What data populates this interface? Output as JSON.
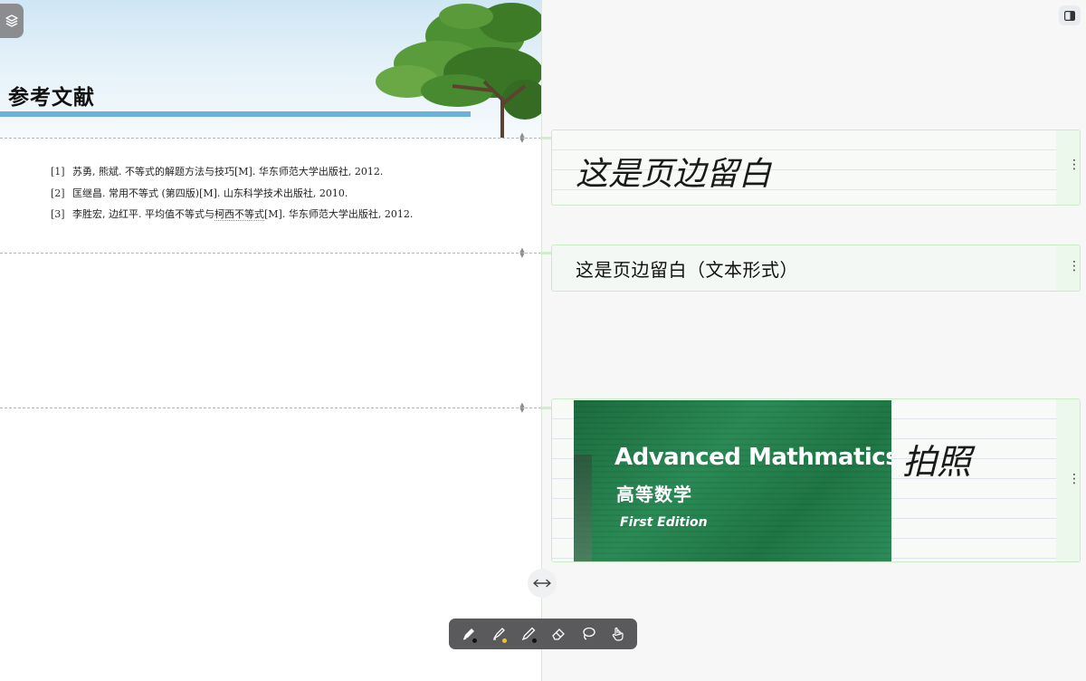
{
  "page": {
    "title": "参考文献",
    "references": [
      {
        "num": "[1]",
        "text": "苏勇, 熊斌. 不等式的解题方法与技巧[M]. 华东师范大学出版社, 2012."
      },
      {
        "num": "[2]",
        "text": "匡继昌. 常用不等式 (第四版)[M]. 山东科学技术出版社, 2010."
      },
      {
        "num": "[3]",
        "text_pre": "李胜宏, 边红平. 平均值不等式与",
        "text_mark": "柯西不等式",
        "text_post": "[M]. 华东师范大学出版社, 2012."
      }
    ]
  },
  "margin_notes": [
    {
      "type": "handwriting",
      "text": "这是页边留白"
    },
    {
      "type": "text",
      "text": "这是页边留白（文本形式）"
    },
    {
      "type": "image",
      "photo": {
        "title": "Advanced Mathmatics",
        "subtitle": "高等数学",
        "edition": "First Edition"
      },
      "handwriting": "拍照"
    }
  ],
  "toolbar": {
    "tools": [
      {
        "name": "pen",
        "dot_color": "#111111"
      },
      {
        "name": "highlighter",
        "dot_color": "#f5c518"
      },
      {
        "name": "pencil",
        "dot_color": "#111111"
      },
      {
        "name": "eraser"
      },
      {
        "name": "lasso"
      },
      {
        "name": "hand"
      }
    ]
  },
  "colors": {
    "accent_bar": "#6cb2d8",
    "note_border": "#c9ecc6",
    "toolbar_bg": "#5a5a5c"
  }
}
